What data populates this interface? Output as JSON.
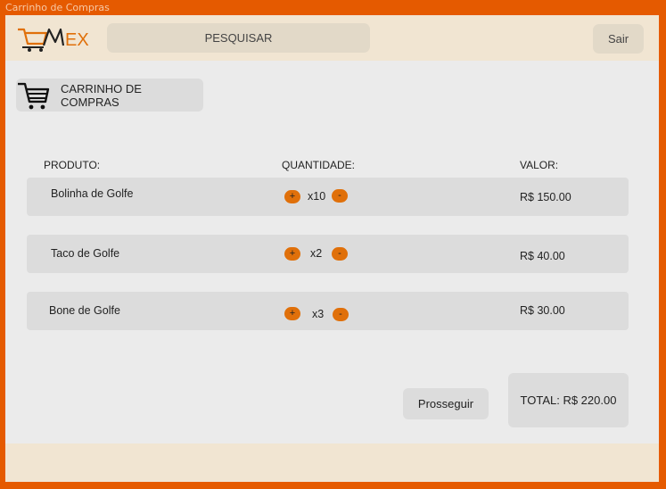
{
  "window": {
    "title": "Carrinho de Compras"
  },
  "header": {
    "logo_text": "MEX",
    "search_placeholder": "PESQUISAR",
    "exit_label": "Sair"
  },
  "cart": {
    "heading": "CARRINHO DE COMPRAS",
    "columns": {
      "product": "PRODUTO:",
      "quantity": "QUANTIDADE:",
      "value": "VALOR:"
    },
    "items": [
      {
        "name": "Bolinha de Golfe",
        "plus": "+",
        "qty": "x10",
        "minus": "-",
        "price": "R$ 150.00"
      },
      {
        "name": "Taco de Golfe",
        "plus": "+",
        "qty": "x2",
        "minus": "-",
        "price": "R$ 40.00"
      },
      {
        "name": "Bone de Golfe",
        "plus": "+",
        "qty": "x3",
        "minus": "-",
        "price": "R$ 30.00"
      }
    ],
    "proceed_label": "Prosseguir",
    "total_label": "TOTAL: R$ 220.00"
  },
  "colors": {
    "accent": "#e55a00",
    "button_orange": "#e0700a",
    "header_bg": "#f1e5d2",
    "content_bg": "#ebebeb"
  },
  "icons": {
    "logo": "cart-logo-icon",
    "heading": "shopping-cart-icon"
  }
}
